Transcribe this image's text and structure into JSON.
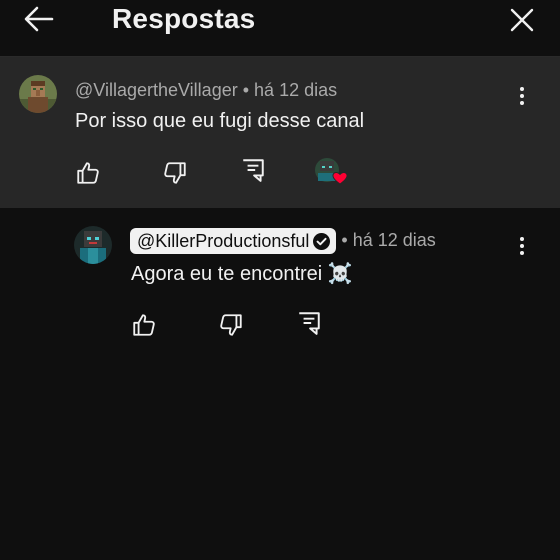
{
  "header": {
    "title": "Respostas",
    "back_icon": "arrow-left-icon",
    "close_icon": "close-icon"
  },
  "parent_comment": {
    "author": "@VillagertheVillager",
    "separator": "•",
    "timestamp": "há 12 dias",
    "text": "Por isso que eu fugi desse canal",
    "actions": [
      "like-icon",
      "dislike-icon",
      "reply-icon",
      "creator-heart-icon"
    ]
  },
  "reply": {
    "author": "@KillerProductionsful",
    "verified": true,
    "separator": "•",
    "timestamp": "há 12 dias",
    "text": "Agora eu te encontrei ☠️",
    "actions": [
      "like-icon",
      "dislike-icon",
      "reply-icon"
    ]
  },
  "colors": {
    "background": "#0f0f0f",
    "highlight": "#272727",
    "heart": "#ff0033",
    "text_primary": "#f1f1f1",
    "text_secondary": "#aaaaaa"
  }
}
